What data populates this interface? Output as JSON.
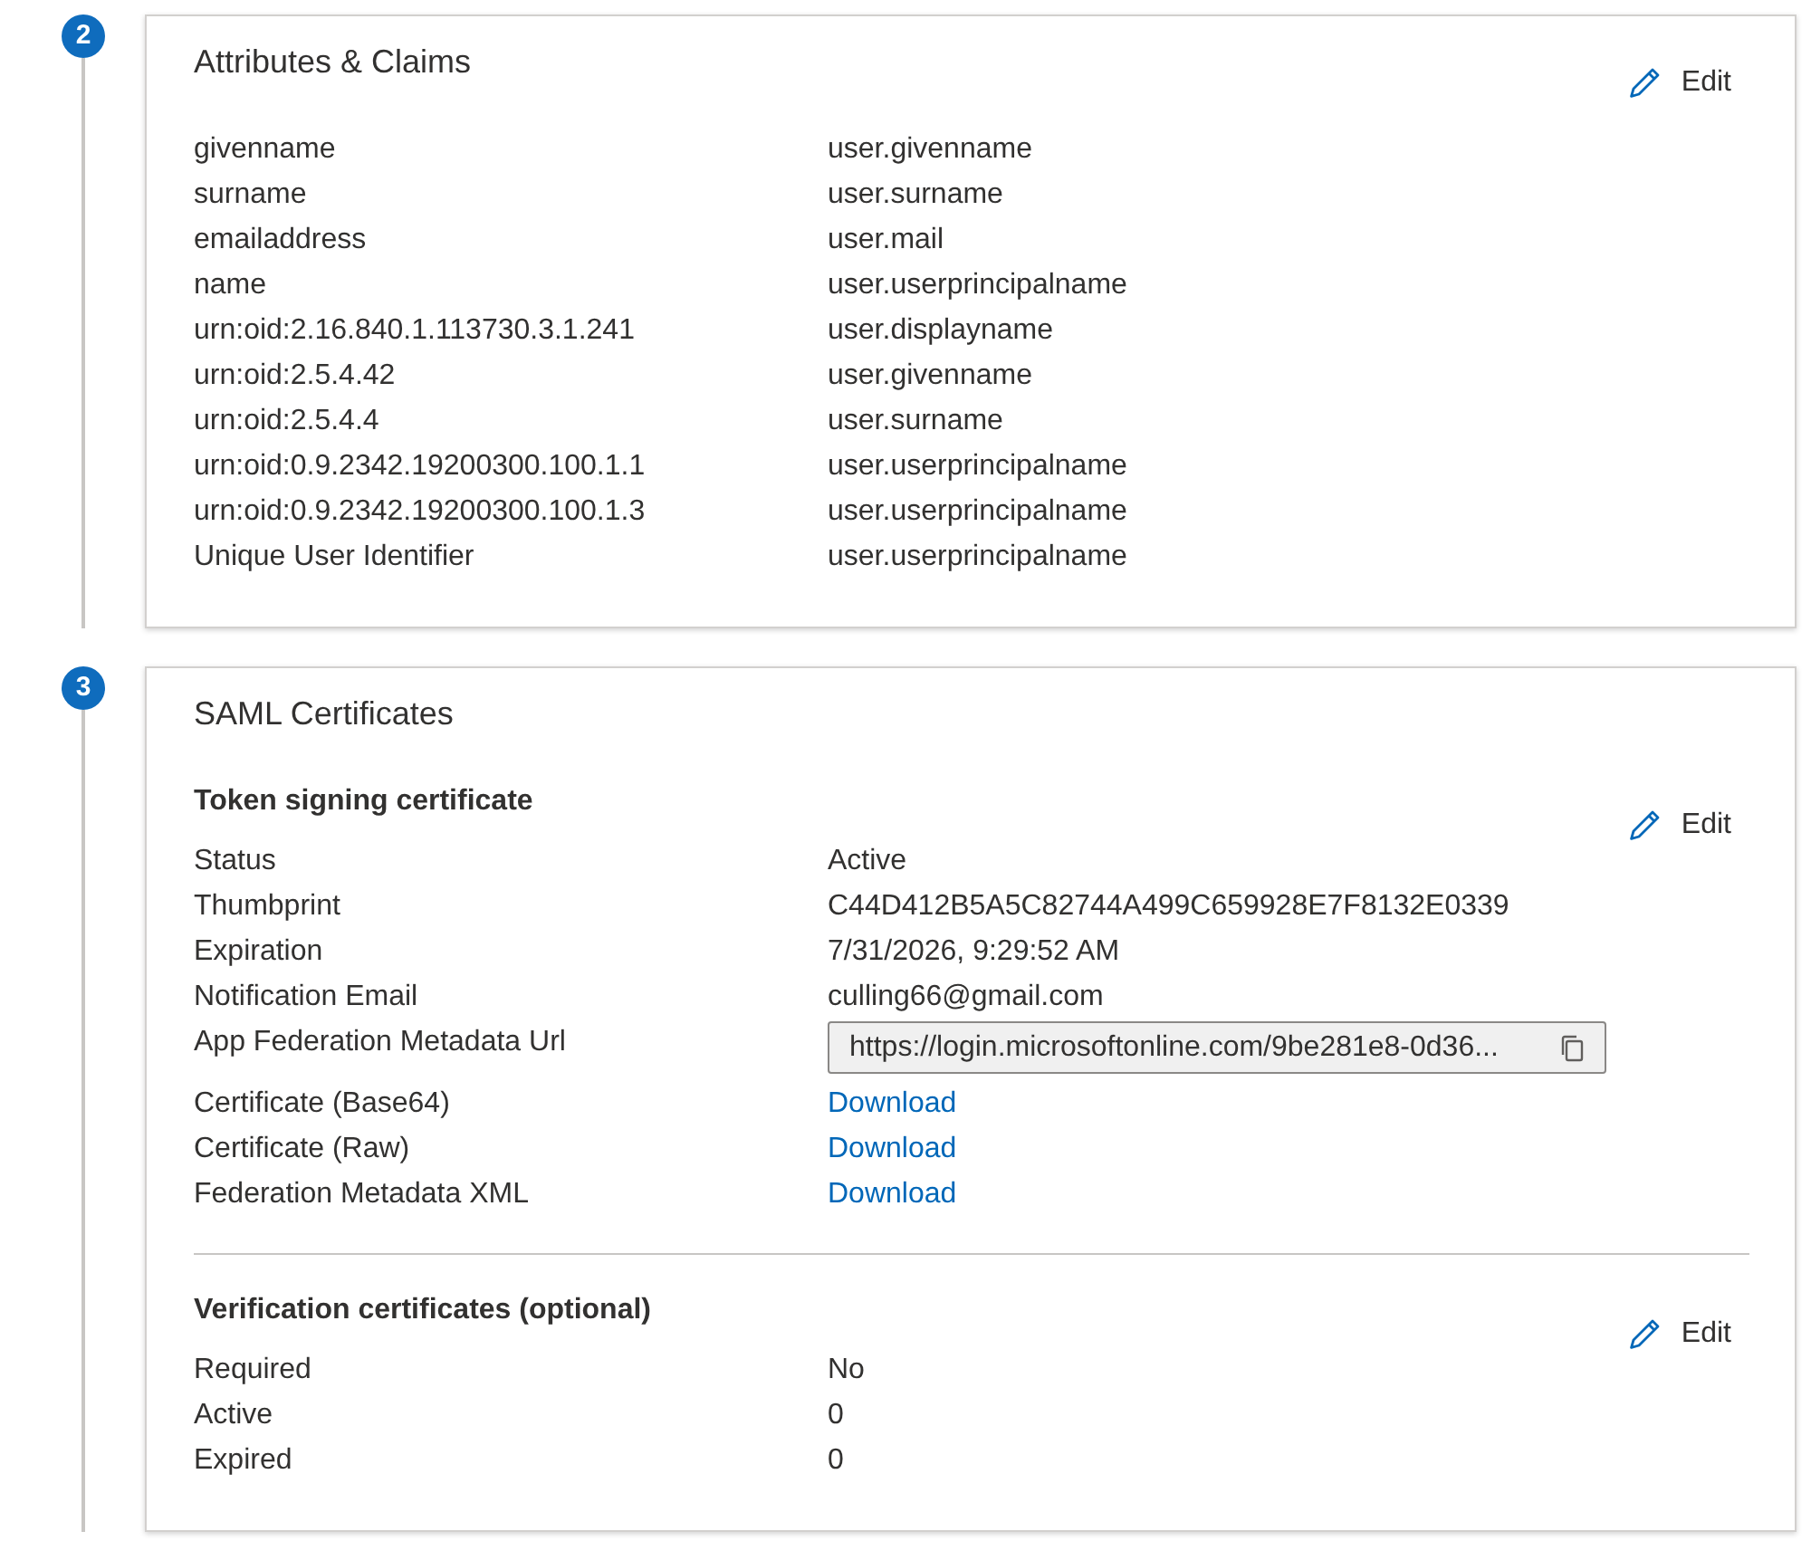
{
  "steps": [
    {
      "number": "2",
      "title": "Attributes & Claims",
      "edit": "Edit",
      "groups": [
        {
          "rows": [
            {
              "kind": "text",
              "label": "givenname",
              "value": "user.givenname"
            },
            {
              "kind": "text",
              "label": "surname",
              "value": "user.surname"
            },
            {
              "kind": "text",
              "label": "emailaddress",
              "value": "user.mail"
            },
            {
              "kind": "text",
              "label": "name",
              "value": "user.userprincipalname"
            },
            {
              "kind": "text",
              "label": "urn:oid:2.16.840.1.113730.3.1.241",
              "value": "user.displayname"
            },
            {
              "kind": "text",
              "label": "urn:oid:2.5.4.42",
              "value": "user.givenname"
            },
            {
              "kind": "text",
              "label": "urn:oid:2.5.4.4",
              "value": "user.surname"
            },
            {
              "kind": "text",
              "label": "urn:oid:0.9.2342.19200300.100.1.1",
              "value": "user.userprincipalname"
            },
            {
              "kind": "text",
              "label": "urn:oid:0.9.2342.19200300.100.1.3",
              "value": "user.userprincipalname"
            },
            {
              "kind": "text",
              "label": "Unique User Identifier",
              "value": "user.userprincipalname"
            }
          ]
        }
      ]
    },
    {
      "number": "3",
      "title": "SAML Certificates",
      "groups": [
        {
          "heading": "Token signing certificate",
          "edit": "Edit",
          "rows": [
            {
              "kind": "text",
              "label": "Status",
              "value": "Active"
            },
            {
              "kind": "text",
              "label": "Thumbprint",
              "value": "C44D412B5A5C82744A499C659928E7F8132E0339"
            },
            {
              "kind": "text",
              "label": "Expiration",
              "value": "7/31/2026, 9:29:52 AM"
            },
            {
              "kind": "text",
              "label": "Notification Email",
              "value": "culling66@gmail.com"
            },
            {
              "kind": "copy_field",
              "label": "App Federation Metadata Url",
              "value": "https://login.microsoftonline.com/9be281e8-0d36..."
            },
            {
              "kind": "link",
              "label": "Certificate (Base64)",
              "value": "Download"
            },
            {
              "kind": "link",
              "label": "Certificate (Raw)",
              "value": "Download"
            },
            {
              "kind": "link",
              "label": "Federation Metadata XML",
              "value": "Download"
            }
          ]
        },
        {
          "heading": "Verification certificates (optional)",
          "edit": "Edit",
          "rows": [
            {
              "kind": "text",
              "label": "Required",
              "value": "No"
            },
            {
              "kind": "text",
              "label": "Active",
              "value": "0"
            },
            {
              "kind": "text",
              "label": "Expired",
              "value": "0"
            }
          ]
        }
      ]
    }
  ]
}
